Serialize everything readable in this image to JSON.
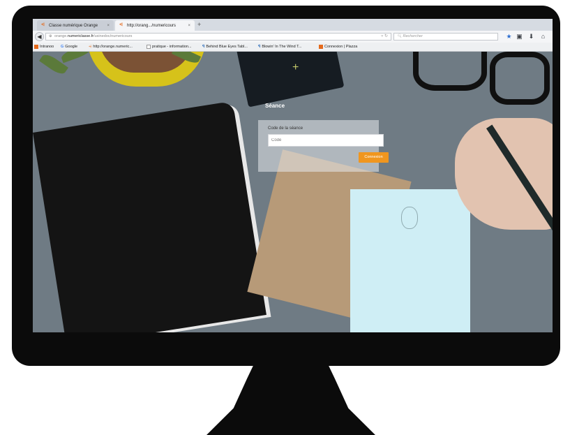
{
  "tabs": [
    {
      "label": "Classe numérique Orange",
      "active": false
    },
    {
      "label": "http://orang.../numericours",
      "active": true
    }
  ],
  "new_tab_symbol": "+",
  "close_symbol": "×",
  "url": {
    "prefix": "orange.",
    "domain": "numericlasse.fr",
    "path": "/usinedoc/numericours"
  },
  "search": {
    "placeholder": "Rechercher"
  },
  "toolbar_icons": [
    "star-icon",
    "clipboard-icon",
    "download-icon",
    "home-icon"
  ],
  "bookmarks": [
    "Intranoo",
    "Google",
    "http://orange.numeric...",
    "pratique - information...",
    "Behind Blue Eyes Tabl...",
    "Blowin' In The Wind T...",
    "Connexion | Plazza"
  ],
  "page": {
    "title": "Séance",
    "field_label": "Code de la séance",
    "field_placeholder": "Code",
    "button_label": "Connexion"
  },
  "colors": {
    "accent": "#f0961f",
    "orange_brand": "#e46a1c",
    "monitor": "#0b0b0b"
  }
}
